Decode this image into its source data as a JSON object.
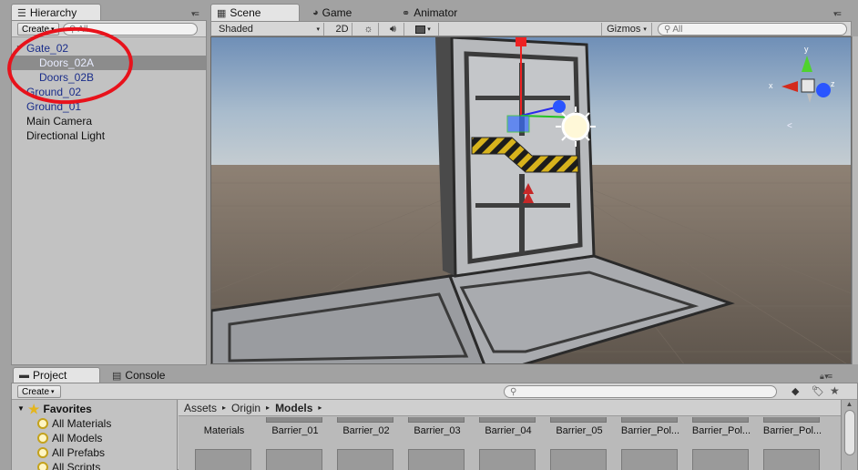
{
  "hierarchy": {
    "tab_label": "Hierarchy",
    "create_label": "Create",
    "search_placeholder": "All",
    "items": [
      {
        "label": "Gate_02"
      },
      {
        "label": "Doors_02A"
      },
      {
        "label": "Doors_02B"
      },
      {
        "label": "Ground_02"
      },
      {
        "label": "Ground_01"
      },
      {
        "label": "Main Camera"
      },
      {
        "label": "Directional Light"
      }
    ]
  },
  "tabs": {
    "scene": "Scene",
    "game": "Game",
    "animator": "Animator"
  },
  "scene_toolbar": {
    "draw_mode": "Shaded",
    "mode_2d": "2D",
    "gizmos_label": "Gizmos",
    "search_placeholder": "All"
  },
  "gizmo": {
    "axis_x": "x",
    "axis_y": "y",
    "axis_z": "z",
    "persp_mark": "<"
  },
  "project": {
    "tab_label": "Project",
    "console_tab_label": "Console",
    "create_label": "Create",
    "favorites_label": "Favorites",
    "favorites": [
      {
        "label": "All Materials"
      },
      {
        "label": "All Models"
      },
      {
        "label": "All Prefabs"
      },
      {
        "label": "All Scripts"
      }
    ],
    "breadcrumb": [
      "Assets",
      "Origin",
      "Models"
    ],
    "assets": [
      {
        "label": "Materials"
      },
      {
        "label": "Barrier_01"
      },
      {
        "label": "Barrier_02"
      },
      {
        "label": "Barrier_03"
      },
      {
        "label": "Barrier_04"
      },
      {
        "label": "Barrier_05"
      },
      {
        "label": "Barrier_Pol..."
      },
      {
        "label": "Barrier_Pol..."
      },
      {
        "label": "Barrier_Pol..."
      }
    ]
  },
  "colors": {
    "annotation": "#e8121b",
    "selection": "#8c8c8c",
    "prefab_text": "#1a2d8a"
  }
}
